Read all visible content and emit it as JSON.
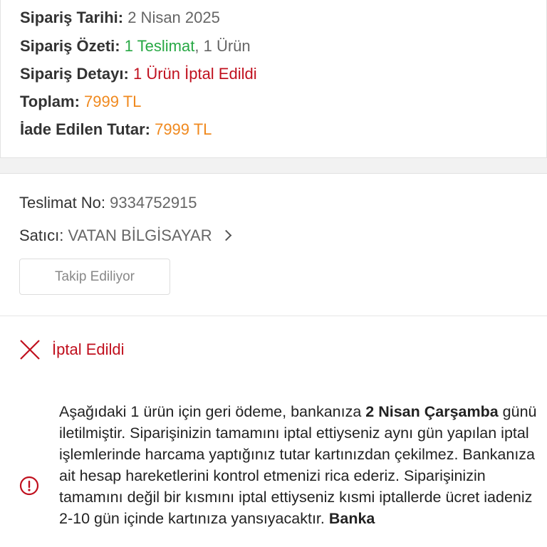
{
  "summary": {
    "date_label": "Sipariş Tarihi:",
    "date_value": "2 Nisan 2025",
    "overview_label": "Sipariş Özeti:",
    "overview_delivery": "1 Teslimat",
    "overview_sep": ",",
    "overview_items": "1 Ürün",
    "detail_label": "Sipariş Detayı:",
    "detail_value": "1 Ürün İptal Edildi",
    "total_label": "Toplam:",
    "total_value": "7999 TL",
    "refund_label": "İade Edilen Tutar:",
    "refund_value": "7999 TL"
  },
  "delivery": {
    "number_label": "Teslimat No:",
    "number_value": "9334752915",
    "seller_label": "Satıcı:",
    "seller_value": "VATAN BİLGİSAYAR",
    "track_button": "Takip Ediliyor",
    "status_text": "İptal Edildi"
  },
  "notice": {
    "p1": "Aşağıdaki 1 ürün için geri ödeme, bankanıza ",
    "b1": "2 Nisan Çarşamba",
    "p2": " günü iletilmiştir. Siparişinizin tamamını iptal ettiyseniz aynı gün yapılan iptal işlemlerinde harcama yaptığınız tutar kartınızdan çekilmez. Bankanıza ait hesap hareketlerini kontrol etmenizi rica ederiz. Siparişinizin tamamını değil bir kısmını iptal ettiyseniz kısmi iptallerde ücret iadeniz 2-10 gün içinde kartınıza yansıyacaktır. ",
    "b2": "Banka"
  },
  "icons": {
    "cancel": "close-x-icon",
    "info": "info-circle-icon"
  },
  "colors": {
    "green": "#27a844",
    "red": "#c0101e",
    "orange": "#f0891e"
  }
}
